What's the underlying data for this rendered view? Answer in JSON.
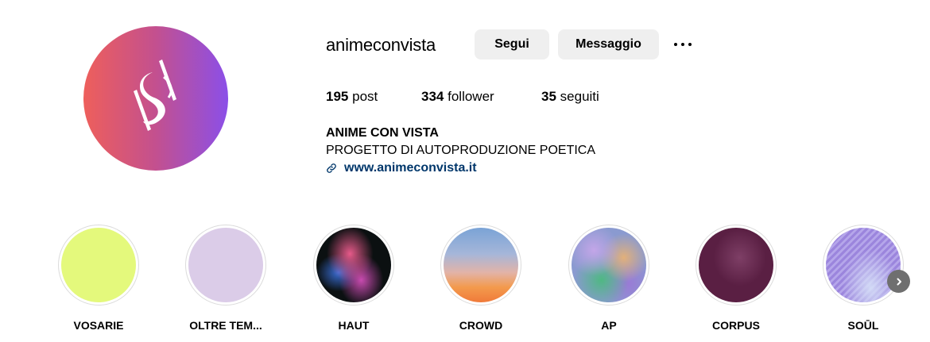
{
  "profile": {
    "username": "animeconvista",
    "follow_label": "Segui",
    "message_label": "Messaggio",
    "more_icon": "more-horizontal-icon",
    "avatar_colors": [
      "#ee5f5b",
      "#8b4fe8"
    ]
  },
  "stats": {
    "posts_count": "195",
    "posts_label": "post",
    "followers_count": "334",
    "followers_label": "follower",
    "following_count": "35",
    "following_label": "seguiti"
  },
  "bio": {
    "name": "ANIME CON VISTA",
    "text": "PROGETTO DI AUTOPRODUZIONE POETICA",
    "link": "www.animeconvista.it",
    "link_icon": "link-icon",
    "link_color": "#00376b"
  },
  "highlights": [
    {
      "label": "VOSARIE"
    },
    {
      "label": "OLTRE TEM..."
    },
    {
      "label": "HAUT"
    },
    {
      "label": "CROWD"
    },
    {
      "label": "AP"
    },
    {
      "label": "CORPUS"
    },
    {
      "label": "SOŪL"
    }
  ],
  "navigation": {
    "next_icon": "chevron-right-icon"
  }
}
